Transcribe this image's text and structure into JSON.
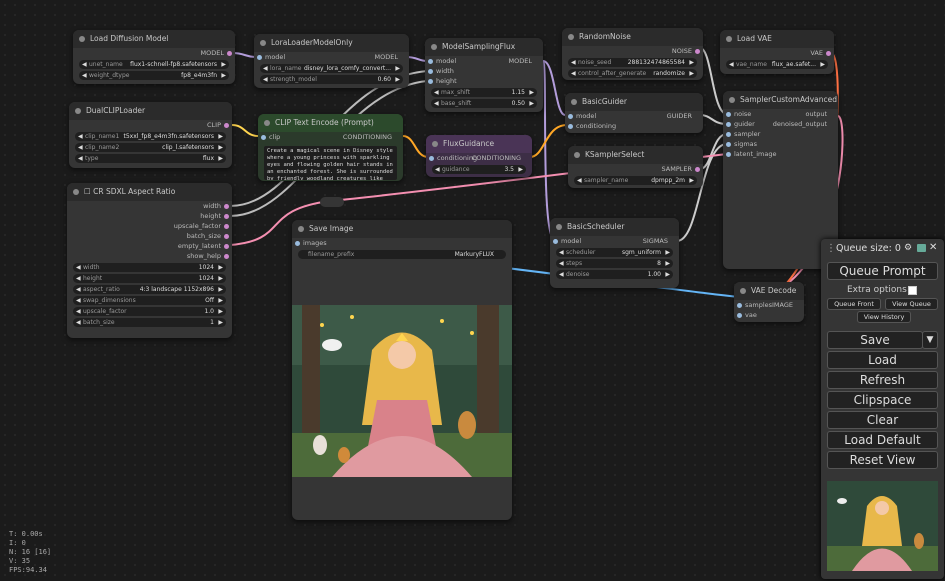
{
  "status": {
    "t": "T: 0.00s",
    "i": "I: 0",
    "n": "N: 16 [16]",
    "v": "V: 35",
    "fps": "FPS:94.34"
  },
  "nodes": {
    "load_diffusion": {
      "title": "Load Diffusion Model",
      "out": "MODEL",
      "unet_name_label": "unet_name",
      "unet_name": "flux1-schnell-fp8.safetensors",
      "weight_dtype_label": "weight_dtype",
      "weight_dtype": "fp8_e4m3fn"
    },
    "lora": {
      "title": "LoraLoaderModelOnly",
      "in": "model",
      "out": "MODEL",
      "lora_name_label": "lora_name",
      "lora_name": "disney_lora_comfy_convert...",
      "strength_label": "strength_model",
      "strength": "0.60"
    },
    "msf": {
      "title": "ModelSamplingFlux",
      "in_model": "model",
      "in_width": "width",
      "in_height": "height",
      "out": "MODEL",
      "max_shift_label": "max_shift",
      "max_shift": "1.15",
      "base_shift_label": "base_shift",
      "base_shift": "0.50"
    },
    "noise": {
      "title": "RandomNoise",
      "out": "NOISE",
      "seed_label": "noise_seed",
      "seed": "288132474865584",
      "cag_label": "control_after_generate",
      "cag": "randomize"
    },
    "vae": {
      "title": "Load VAE",
      "out": "VAE",
      "vae_name_label": "vae_name",
      "vae_name": "flux_ae.safet..."
    },
    "clip": {
      "title": "DualCLIPLoader",
      "out": "CLIP",
      "c1_label": "clip_name1",
      "c1": "t5xxl_fp8_e4m3fn.safetensors",
      "c2_label": "clip_name2",
      "c2": "clip_l.safetensors",
      "type_label": "type",
      "type": "flux"
    },
    "encode": {
      "title": "CLIP Text Encode (Prompt)",
      "in": "clip",
      "out": "CONDITIONING",
      "prompt": "Create a magical scene in Disney style where a young princess with sparkling eyes and flowing golden hair stands in an enchanted forest. She is surrounded by friendly woodland creatures like rabbits, birds, and deer, all drawn in a"
    },
    "guidance": {
      "title": "FluxGuidance",
      "in": "conditioning",
      "out": "CONDITIONING",
      "g_label": "guidance",
      "g": "3.5"
    },
    "guider": {
      "title": "BasicGuider",
      "in_model": "model",
      "in_cond": "conditioning",
      "out": "GUIDER"
    },
    "ksel": {
      "title": "KSamplerSelect",
      "out": "SAMPLER",
      "s_label": "sampler_name",
      "s": "dpmpp_2m"
    },
    "sca": {
      "title": "SamplerCustomAdvanced",
      "in_noise": "noise",
      "in_guider": "guider",
      "in_sampler": "sampler",
      "in_sigmas": "sigmas",
      "in_latent": "latent_image",
      "out1": "output",
      "out2": "denoised_output"
    },
    "aspect": {
      "title": "CR SDXL Aspect Ratio",
      "o1": "width",
      "o2": "height",
      "o3": "upscale_factor",
      "o4": "batch_size",
      "o5": "empty_latent",
      "o6": "show_help",
      "w_label": "width",
      "w": "1024",
      "h_label": "height",
      "h": "1024",
      "ar_label": "aspect_ratio",
      "ar": "4:3 landscape 1152x896",
      "sw_label": "swap_dimensions",
      "sw": "Off",
      "uf_label": "upscale_factor",
      "uf": "1.0",
      "bs_label": "batch_size",
      "bs": "1"
    },
    "save": {
      "title": "Save Image",
      "in": "images",
      "fp_label": "filename_prefix",
      "fp": "MarkuryFLUX"
    },
    "sched": {
      "title": "BasicScheduler",
      "in": "model",
      "out": "SIGMAS",
      "sc_label": "scheduler",
      "sc": "sgm_uniform",
      "st_label": "steps",
      "st": "8",
      "dn_label": "denoise",
      "dn": "1.00"
    },
    "decode": {
      "title": "VAE Decode",
      "in1": "samples",
      "in2": "vae",
      "out": "IMAGE"
    }
  },
  "menu": {
    "queue_size": "Queue size: 0",
    "queue_prompt": "Queue Prompt",
    "extra": "Extra options",
    "queue_front": "Queue Front",
    "view_queue": "View Queue",
    "view_history": "View History",
    "save": "Save",
    "load": "Load",
    "refresh": "Refresh",
    "clipspace": "Clipspace",
    "clear": "Clear",
    "load_default": "Load Default",
    "reset_view": "Reset View"
  },
  "colors": {
    "model": "#b39ddb",
    "clip": "#ffd54f",
    "conditioning": "#ffa726",
    "latent": "#f48fb1",
    "vae": "#ff7043",
    "image": "#64b5f6",
    "node_bg": "#353535"
  }
}
